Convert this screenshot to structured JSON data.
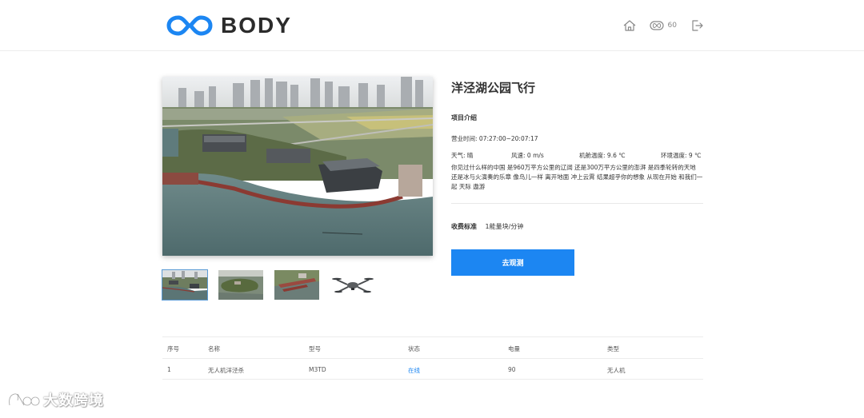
{
  "header": {
    "brand": "BODY",
    "energy_count": "60",
    "icons": [
      "infinity-logo-icon",
      "home-icon",
      "energy-icon",
      "logout-icon"
    ]
  },
  "project": {
    "title": "洋泾湖公园飞行",
    "intro_heading": "项目介绍",
    "hours_label": "营业时间:",
    "hours_value": "07:27:00~20:07:17",
    "weather_label": "天气:",
    "weather_value": "晴",
    "wind_label": "风速:",
    "wind_value": "0 m/s",
    "device_temp_label": "机舱温度:",
    "device_temp_value": "9.6 ℃",
    "env_temp_label": "环境温度:",
    "env_temp_value": "9 ℃",
    "description": "你见过什么样的中国 是960万平方公里的辽阔 还是300万平方公里的澎湃 是四季轮转的天地 还是冰与火演奏的乐章 像鸟儿一样 离开地面 冲上云霄 结果超乎你的想象 从现在开始 和我们一起 天际 遨游",
    "price_label": "收费标准",
    "price_value": "1能量块/分钟",
    "button_label": "去观测"
  },
  "thumbnails": [
    {
      "name": "aerial-park-thumb",
      "active": true
    },
    {
      "name": "aerial-island-thumb",
      "active": false
    },
    {
      "name": "aerial-pier-thumb",
      "active": false
    },
    {
      "name": "drone-thumb",
      "active": false
    }
  ],
  "table": {
    "headers": [
      "序号",
      "名称",
      "型号",
      "状态",
      "电量",
      "类型"
    ],
    "rows": [
      [
        "1",
        "无人机洋泾杀",
        "M3TD",
        "在线",
        "90",
        "无人机"
      ]
    ]
  },
  "watermark": {
    "text": "大数跨境"
  },
  "colors": {
    "accent": "#1c86f2",
    "text": "#333333",
    "divider": "#ececec"
  }
}
